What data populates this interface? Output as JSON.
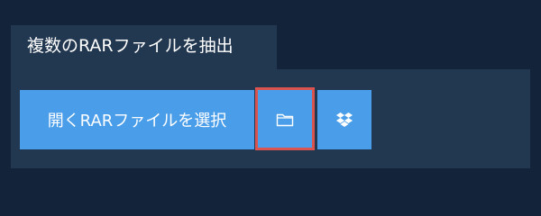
{
  "section": {
    "title": "複数のRARファイルを抽出"
  },
  "actions": {
    "select_files_label": "開くRARファイルを選択",
    "folder_icon": "folder-icon",
    "dropbox_icon": "dropbox-icon"
  },
  "colors": {
    "background": "#13243a",
    "panel": "#223750",
    "button": "#4a9de8",
    "highlight": "#d9534f"
  }
}
